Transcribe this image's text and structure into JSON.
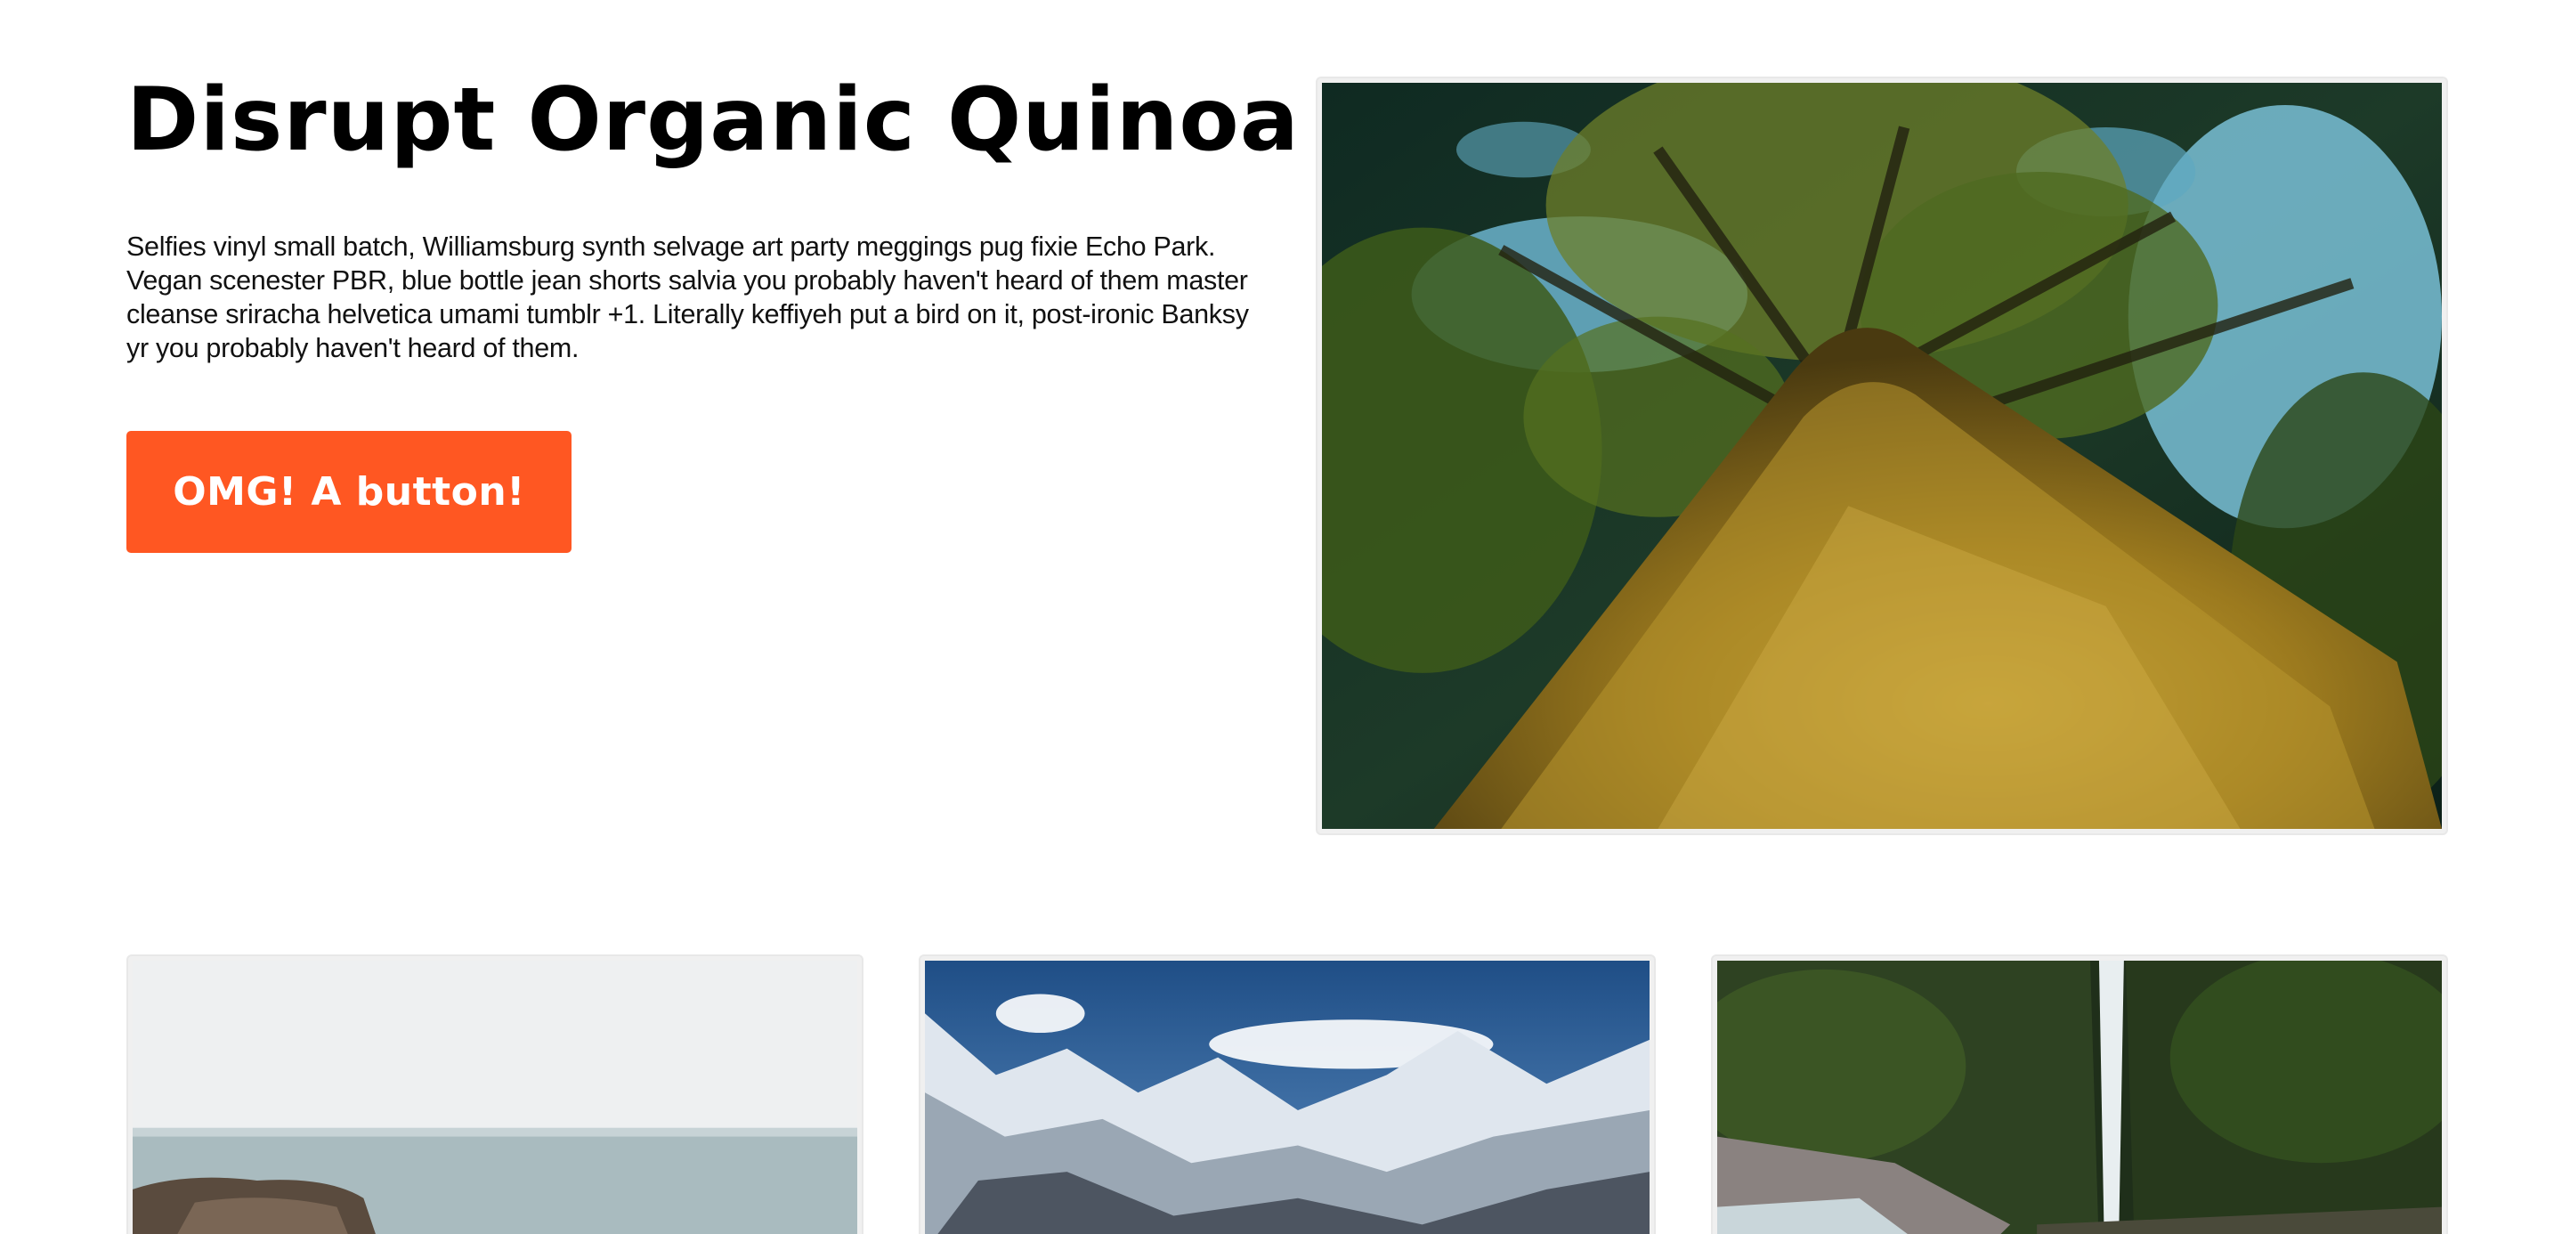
{
  "hero": {
    "title": "Disrupt Organic Quinoa",
    "body": "Selfies vinyl small batch, Williamsburg synth selvage art party meggings pug fixie Echo Park. Vegan scenester PBR, blue bottle jean shorts salvia you probably haven't heard of them master cleanse sriracha helvetica umami tumblr +1. Literally keffiyeh put a bird on it, post-ironic Banksy yr you probably haven't heard of them.",
    "button_label": "OMG! A button!",
    "image": "mossy-tree-trunk-photo"
  },
  "gallery": [
    {
      "image": "rocky-coast-sea-photo"
    },
    {
      "image": "snowy-mountains-photo"
    },
    {
      "image": "forest-waterfall-photo"
    }
  ],
  "colors": {
    "accent": "#ff5722",
    "text": "#000000",
    "frame": "#f0f0f0",
    "background": "#ffffff"
  }
}
